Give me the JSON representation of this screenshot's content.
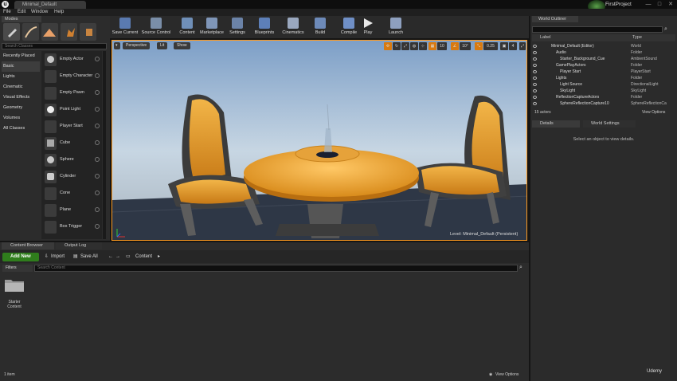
{
  "window": {
    "tab_title": "Minimal_Default",
    "project_name": "FirstProject",
    "minimize": "—",
    "maximize": "□",
    "close": "✕"
  },
  "menu": [
    "File",
    "Edit",
    "Window",
    "Help"
  ],
  "modes": {
    "tab": "Modes",
    "search_placeholder": "Search Classes",
    "categories": [
      "Recently Placed",
      "Basic",
      "Lights",
      "Cinematic",
      "Visual Effects",
      "Geometry",
      "Volumes",
      "All Classes"
    ],
    "items": [
      "Empty Actor",
      "Empty Character",
      "Empty Pawn",
      "Point Light",
      "Player Start",
      "Cube",
      "Sphere",
      "Cylinder",
      "Cone",
      "Plane",
      "Box Trigger"
    ]
  },
  "toolbar": [
    {
      "label": "Save Current",
      "icon": "save-icon",
      "color": "#5a7ab0"
    },
    {
      "label": "Source Control",
      "icon": "source-control-icon",
      "color": "#7a8ea8"
    },
    {
      "label": "Content",
      "icon": "content-icon",
      "color": "#6f8fb8"
    },
    {
      "label": "Marketplace",
      "icon": "marketplace-icon",
      "color": "#7f96b8"
    },
    {
      "label": "Settings",
      "icon": "settings-icon",
      "color": "#6b83a8"
    },
    {
      "label": "Blueprints",
      "icon": "blueprints-icon",
      "color": "#5d7fb8"
    },
    {
      "label": "Cinematics",
      "icon": "cinematics-icon",
      "color": "#9aa8bf"
    },
    {
      "label": "Build",
      "icon": "build-icon",
      "color": "#6d8ab9"
    },
    {
      "label": "Compile",
      "icon": "compile-icon",
      "color": "#6f8fc6"
    },
    {
      "label": "Play",
      "icon": "play-icon",
      "color": "#7a94c8"
    },
    {
      "label": "Launch",
      "icon": "launch-icon",
      "color": "#8ea0bf"
    }
  ],
  "viewport": {
    "perspective": "Perspective",
    "lit": "Lit",
    "show": "Show",
    "grid_snap": "10",
    "rot_snap": "10°",
    "scale_snap": "0.25",
    "camera_speed": "4",
    "level_label": "Level:  Minimal_Default (Persistent)"
  },
  "outliner": {
    "tab": "World Outliner",
    "col_label": "Label",
    "col_type": "Type",
    "rows": [
      {
        "label": "Minimal_Default (Editor)",
        "type": "World",
        "indent": 0
      },
      {
        "label": "Audio",
        "type": "Folder",
        "indent": 1
      },
      {
        "label": "Starter_Background_Cue",
        "type": "AmbientSound",
        "indent": 2
      },
      {
        "label": "GamePlayActors",
        "type": "Folder",
        "indent": 1
      },
      {
        "label": "Player Start",
        "type": "PlayerStart",
        "indent": 2
      },
      {
        "label": "Lights",
        "type": "Folder",
        "indent": 1
      },
      {
        "label": "Light Source",
        "type": "DirectionalLight",
        "indent": 2
      },
      {
        "label": "SkyLight",
        "type": "SkyLight",
        "indent": 2
      },
      {
        "label": "ReflectionCaptureActors",
        "type": "Folder",
        "indent": 1
      },
      {
        "label": "SphereReflectionCapture10",
        "type": "SphereReflectionCa",
        "indent": 2
      }
    ],
    "count": "15 actors",
    "view_options": "View Options"
  },
  "details": {
    "tab1": "Details",
    "tab2": "World Settings",
    "empty": "Select an object to view details."
  },
  "content_browser": {
    "tab1": "Content Browser",
    "tab2": "Output Log",
    "add_new": "Add New",
    "import": "Import",
    "save_all": "Save All",
    "path": "Content",
    "filters": "Filters",
    "search_placeholder": "Search Content",
    "folder_label": "Starter Content",
    "item_count": "1 item",
    "view_options": "View Options"
  },
  "watermark": "Udemy"
}
